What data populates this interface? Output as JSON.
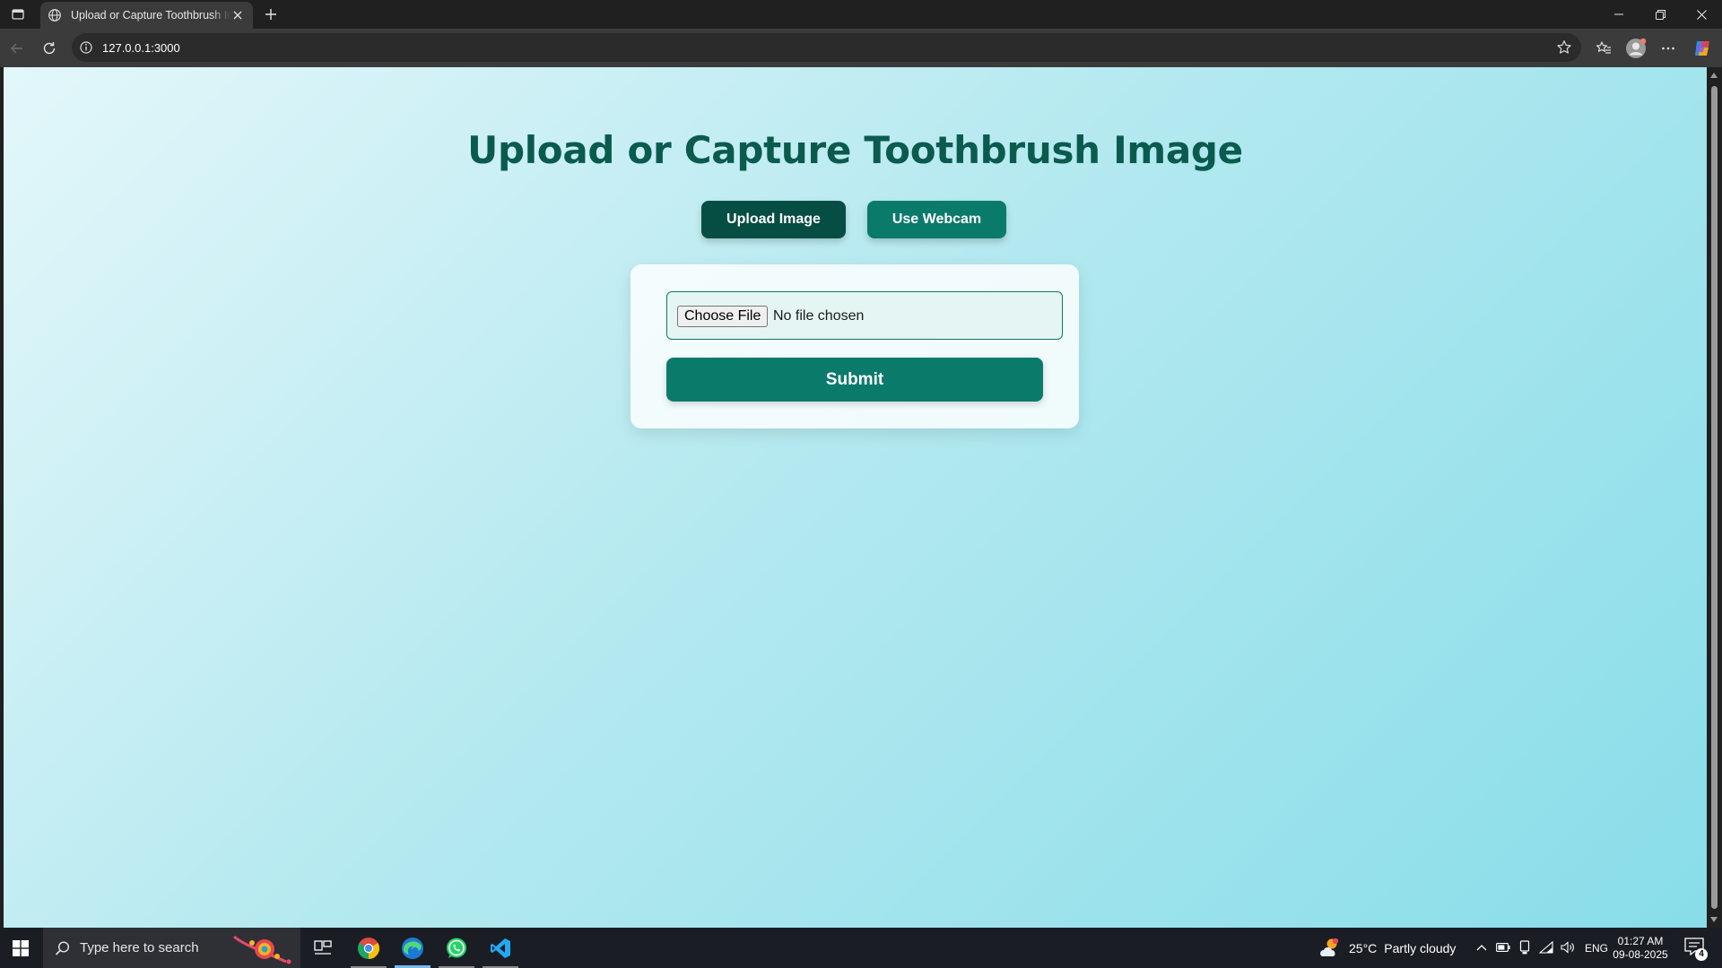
{
  "browser": {
    "tab_title": "Upload or Capture Toothbrush Image",
    "url": "127.0.0.1:3000"
  },
  "page": {
    "title": "Upload or Capture Toothbrush Image",
    "upload_button": "Upload Image",
    "webcam_button": "Use Webcam",
    "choose_file_label": "Choose File",
    "file_status": "No file chosen",
    "submit_label": "Submit"
  },
  "taskbar": {
    "search_placeholder": "Type here to search",
    "weather_temp": "25°C",
    "weather_condition": "Partly cloudy",
    "language": "ENG",
    "time": "01:27 AM",
    "date": "09-08-2025",
    "notification_count": "4"
  },
  "colors": {
    "title": "#0a5b4e",
    "upload_button_bg": "#064d43",
    "primary": "#0a7a6b",
    "bg_start": "#e3f7fa",
    "bg_end": "#88dde9"
  }
}
